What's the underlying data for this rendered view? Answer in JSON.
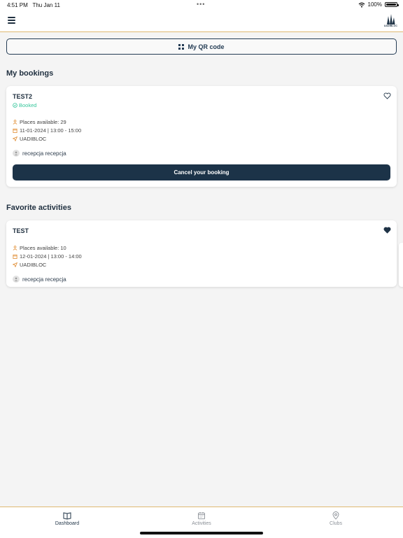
{
  "status_bar": {
    "time": "4:51 PM",
    "date": "Thu Jan 11",
    "battery": "100%"
  },
  "header": {
    "logo_text": "UADIBLOC"
  },
  "qr_button": {
    "label": "My QR code"
  },
  "bookings": {
    "title": "My bookings",
    "items": [
      {
        "name": "TEST2",
        "status": "Booked",
        "places": "Places available: 29",
        "datetime": "11-01-2024 | 13:00 - 15:00",
        "location": "UADIBLOC",
        "instructor": "recepcja recepcja",
        "cancel_label": "Cancel your booking"
      }
    ]
  },
  "favorites": {
    "title": "Favorite activities",
    "items": [
      {
        "name": "TEST",
        "places": "Places available: 10",
        "datetime": "12-01-2024 | 13:00 - 14:00",
        "location": "UADIBLOC",
        "instructor": "recepcja recepcja"
      }
    ]
  },
  "nav": {
    "items": [
      {
        "label": "Dashboard",
        "icon": "book-icon",
        "active": true
      },
      {
        "label": "Activities",
        "icon": "calendar-icon",
        "active": false
      },
      {
        "label": "Clubs",
        "icon": "map-pin-icon",
        "active": false
      }
    ]
  },
  "colors": {
    "primary": "#1c3348",
    "accent": "#e0b972",
    "booked": "#36c69b",
    "background": "#f4f4f4"
  }
}
